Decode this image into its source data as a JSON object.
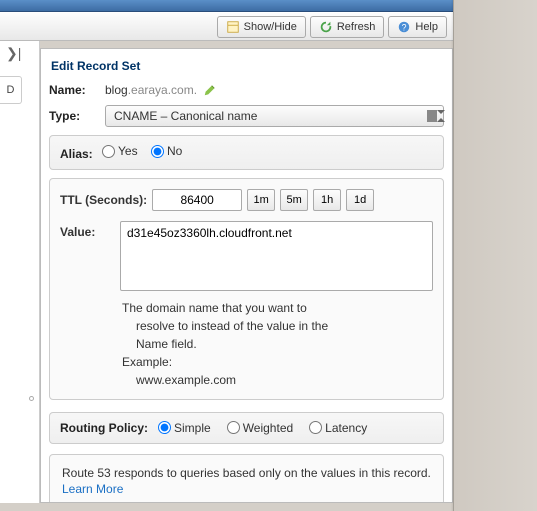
{
  "toolbar": {
    "showhide": "Show/Hide",
    "refresh": "Refresh",
    "help": "Help"
  },
  "sidebar": {
    "collapsed_letter": "D"
  },
  "title": "Edit Record Set",
  "name": {
    "label": "Name:",
    "sub": "blog",
    "domain": ".earaya.com."
  },
  "type": {
    "label": "Type:",
    "selected": "CNAME – Canonical name"
  },
  "alias": {
    "label": "Alias:",
    "yes": "Yes",
    "no": "No"
  },
  "ttl": {
    "label": "TTL (Seconds):",
    "value": "86400",
    "presets": [
      "1m",
      "5m",
      "1h",
      "1d"
    ]
  },
  "value": {
    "label": "Value:",
    "text": "d31e45oz3360lh.cloudfront.net",
    "help_l1": "The domain name that you want to",
    "help_l2": "resolve to instead of the value in the",
    "help_l3": "Name field.",
    "help_l4": "Example:",
    "help_l5": "www.example.com"
  },
  "routing": {
    "label": "Routing Policy:",
    "simple": "Simple",
    "weighted": "Weighted",
    "latency": "Latency"
  },
  "info": {
    "text": "Route 53 responds to queries based only on the values in this record. ",
    "link": "Learn More"
  }
}
